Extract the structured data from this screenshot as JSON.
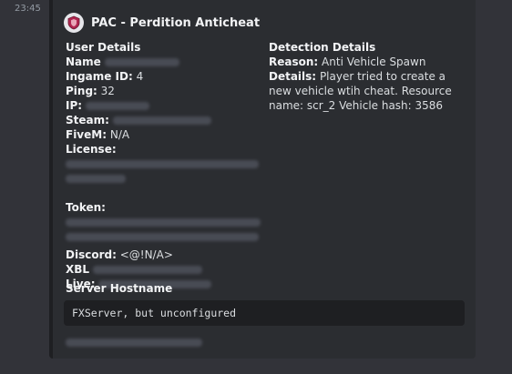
{
  "message": {
    "timestamp": "23:45"
  },
  "embed": {
    "author_name": "PAC - Perdition Anticheat",
    "author_icon": "shield-logo-icon",
    "user_details": {
      "title": "User Details",
      "name_label": "Name",
      "ingame_id_label": "Ingame ID:",
      "ingame_id_value": "4",
      "ping_label": "Ping:",
      "ping_value": "32",
      "ip_label": "IP:",
      "steam_label": "Steam:",
      "fivem_label": "FiveM:",
      "fivem_value": "N/A",
      "license_label": "License:",
      "token_label": "Token:",
      "discord_label": "Discord:",
      "discord_value": "<@!N/A>",
      "xbl_label": "XBL",
      "live_label": "Live:"
    },
    "detection_details": {
      "title": "Detection Details",
      "reason_label": "Reason:",
      "reason_value": "Anti Vehicle Spawn",
      "details_label": "Details:",
      "details_value": "Player tried to create a new vehicle wtih cheat. Resource name: scr_2 Vehicle hash: 3586"
    },
    "server": {
      "title": "Server Hostname",
      "hostname": "FXServer, but unconfigured"
    }
  }
}
